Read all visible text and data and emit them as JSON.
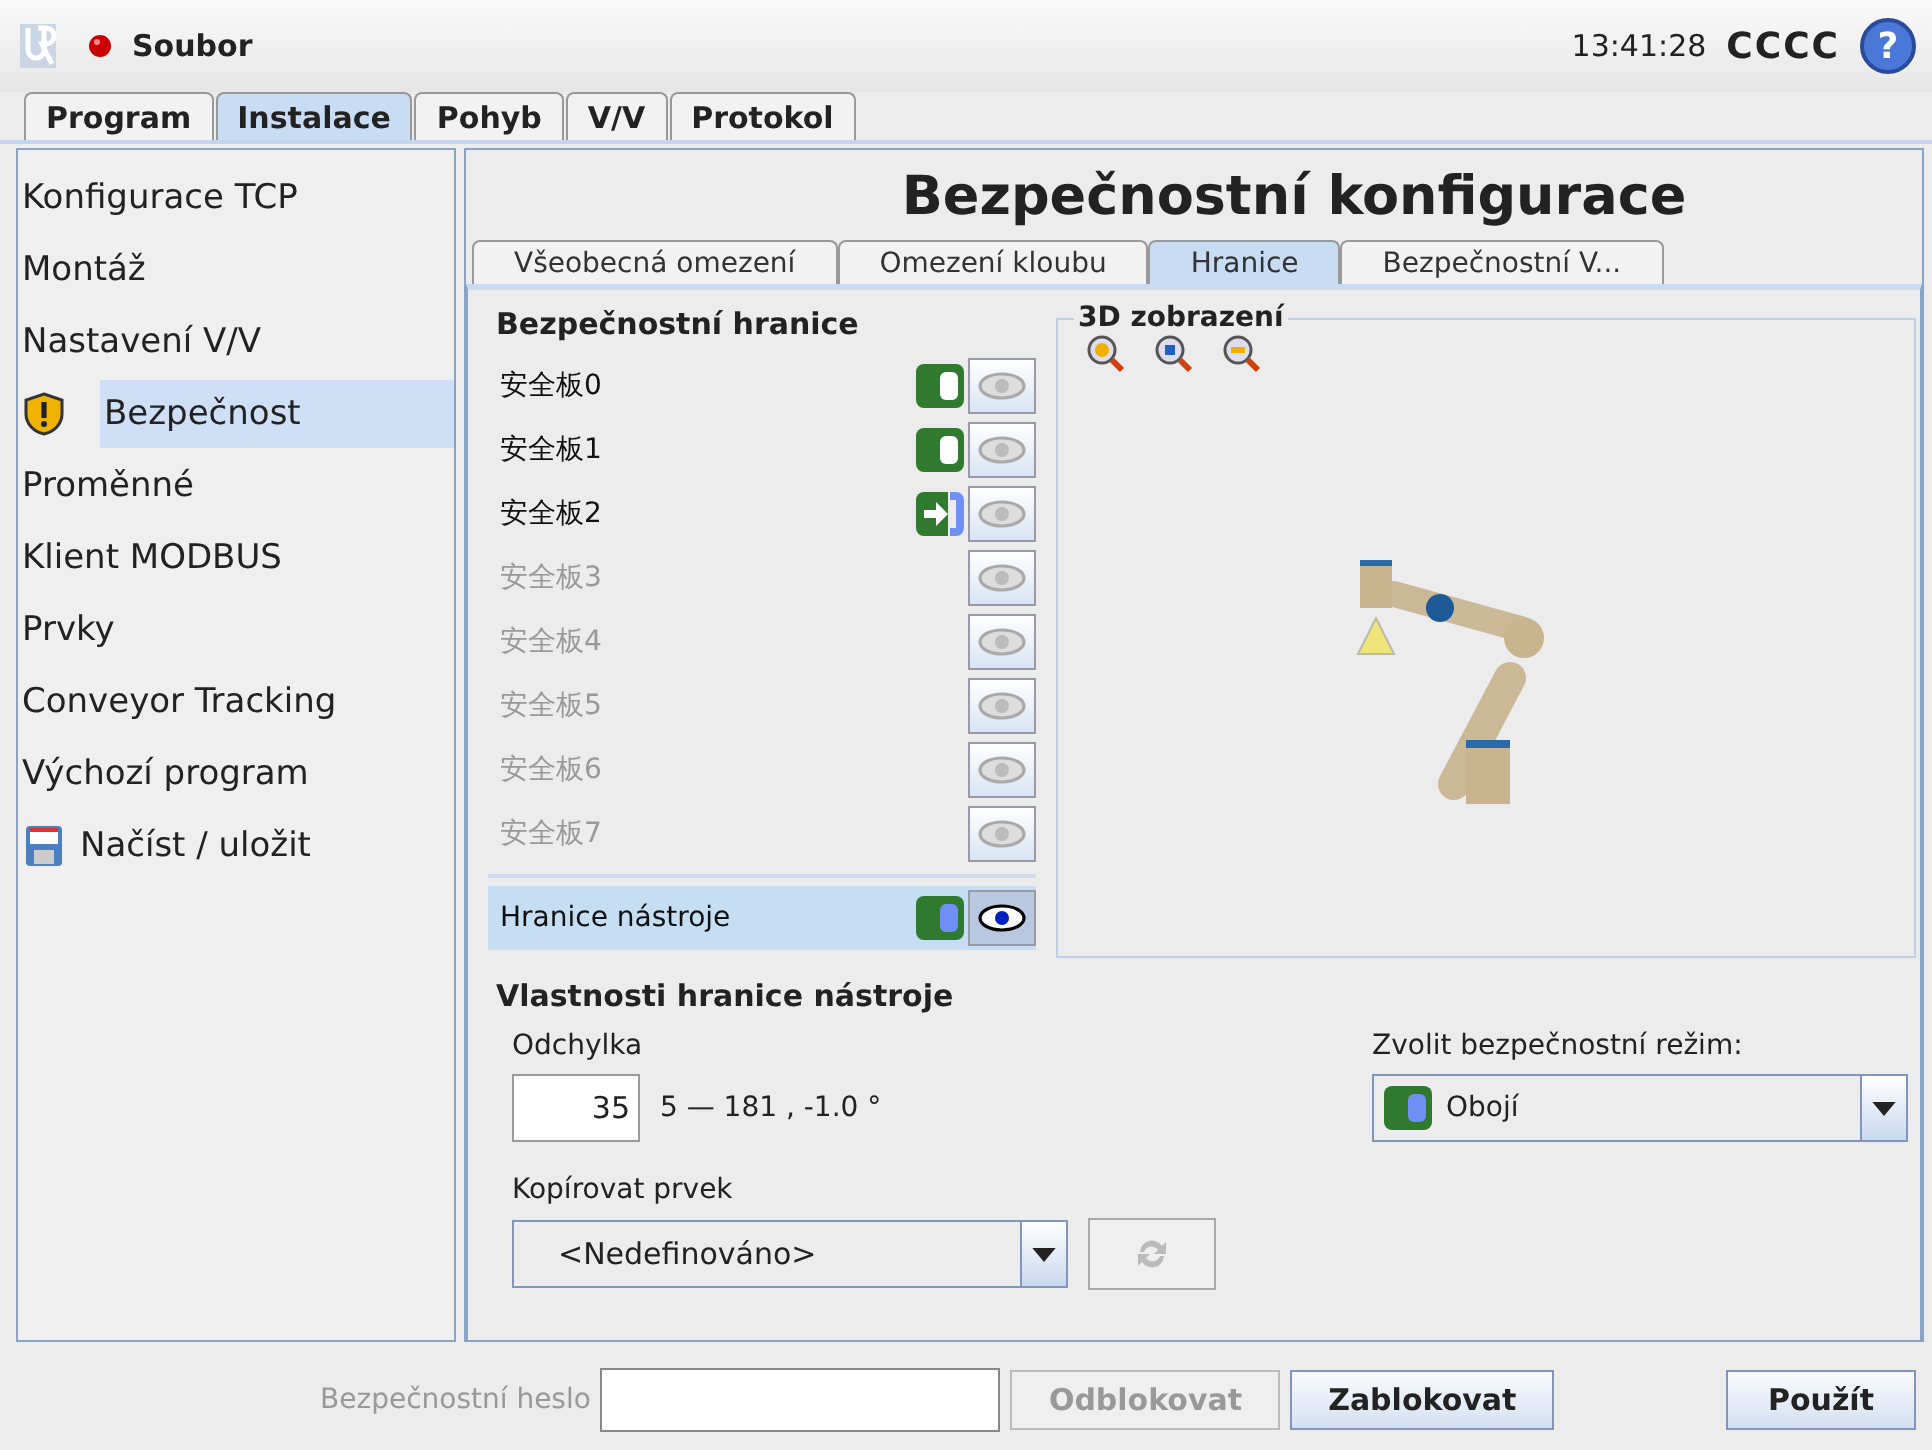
{
  "header": {
    "menu": "Soubor",
    "time": "13:41:28",
    "user": "CCCC",
    "help": "?"
  },
  "main_tabs": [
    {
      "label": "Program",
      "selected": false
    },
    {
      "label": "Instalace",
      "selected": true
    },
    {
      "label": "Pohyb",
      "selected": false
    },
    {
      "label": "V/V",
      "selected": false
    },
    {
      "label": "Protokol",
      "selected": false
    }
  ],
  "sidebar": {
    "items": [
      {
        "label": "Konfigurace TCP",
        "kind": "plain",
        "selected": false
      },
      {
        "label": "Montáž",
        "kind": "plain",
        "selected": false
      },
      {
        "label": "Nastavení V/V",
        "kind": "plain",
        "selected": false
      },
      {
        "label": "Bezpečnost",
        "kind": "warning",
        "selected": true
      },
      {
        "label": "Proměnné",
        "kind": "plain",
        "selected": false
      },
      {
        "label": "Klient MODBUS",
        "kind": "plain",
        "selected": false
      },
      {
        "label": "Prvky",
        "kind": "plain",
        "selected": false
      },
      {
        "label": "Conveyor Tracking",
        "kind": "plain",
        "selected": false
      },
      {
        "label": "Výchozí program",
        "kind": "plain",
        "selected": false
      },
      {
        "label": "Načíst / uložit",
        "kind": "storage",
        "selected": false
      }
    ]
  },
  "title": "Bezpečnostní konfigurace",
  "sub_tabs": [
    {
      "label": "Všeobecná omezení",
      "selected": false
    },
    {
      "label": "Omezení kloubu",
      "selected": false
    },
    {
      "label": "Hranice",
      "selected": true
    },
    {
      "label": "Bezpečnostní V...",
      "selected": false
    }
  ],
  "boundaries": {
    "heading": "Bezpečnostní hranice",
    "items": [
      {
        "name": "安全板0",
        "kind": "normal",
        "disabled": false,
        "visible": false,
        "selected": false
      },
      {
        "name": "安全板1",
        "kind": "normal",
        "disabled": false,
        "visible": false,
        "selected": false
      },
      {
        "name": "安全板2",
        "kind": "trigger",
        "disabled": false,
        "visible": false,
        "selected": false
      },
      {
        "name": "安全板3",
        "kind": "off",
        "disabled": true,
        "visible": false,
        "selected": false
      },
      {
        "name": "安全板4",
        "kind": "off",
        "disabled": true,
        "visible": false,
        "selected": false
      },
      {
        "name": "安全板5",
        "kind": "off",
        "disabled": true,
        "visible": false,
        "selected": false
      },
      {
        "name": "安全板6",
        "kind": "off",
        "disabled": true,
        "visible": false,
        "selected": false
      },
      {
        "name": "安全板7",
        "kind": "off",
        "disabled": true,
        "visible": false,
        "selected": false
      }
    ],
    "tool": {
      "name": "Hranice nástroje",
      "kind": "both",
      "disabled": false,
      "visible": true,
      "selected": true
    }
  },
  "view3d": {
    "legend": "3D zobrazení"
  },
  "properties": {
    "heading": "Vlastnosti hranice nástroje",
    "deviation_label": "Odchylka",
    "deviation_value": "35",
    "range": "5 — 181 , -1.0 °",
    "mode_select": {
      "label": "Zvolit bezpečnostní režim:",
      "value": "Obojí",
      "kind": "both"
    },
    "copy_label": "Kopírovat prvek",
    "copy_value": "<Nedefinováno>"
  },
  "footer": {
    "password_label": "Bezpečnostní heslo",
    "unlock": "Odblokovat",
    "lock": "Zablokovat",
    "apply": "Použít"
  }
}
